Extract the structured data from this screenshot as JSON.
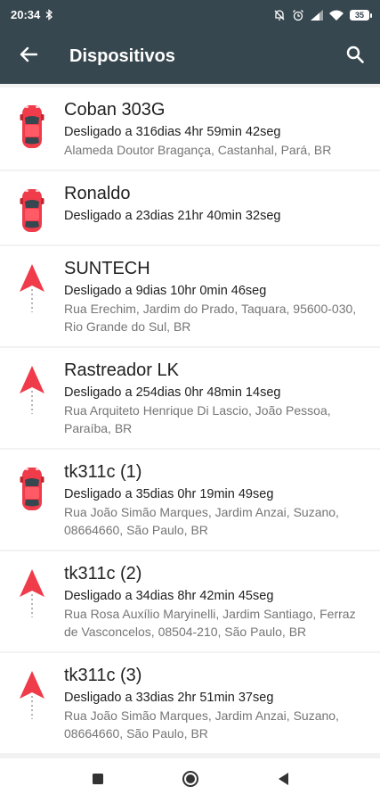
{
  "status_bar": {
    "time": "20:34",
    "battery": "35"
  },
  "header": {
    "title": "Dispositivos"
  },
  "devices": [
    {
      "icon": "car-icon",
      "name": "Coban 303G",
      "status": "Desligado a 316dias 4hr 59min 42seg",
      "address": "Alameda Doutor Bragança, Castanhal, Pará, BR"
    },
    {
      "icon": "car-icon",
      "name": "Ronaldo",
      "status": "Desligado a 23dias 21hr 40min 32seg",
      "address": ""
    },
    {
      "icon": "arrow-icon",
      "name": "SUNTECH",
      "status": "Desligado a 9dias 10hr 0min 46seg",
      "address": "Rua Erechim, Jardim do Prado, Taquara, 95600-030, Rio Grande do Sul, BR"
    },
    {
      "icon": "arrow-icon",
      "name": "Rastreador LK",
      "status": "Desligado a 254dias 0hr 48min 14seg",
      "address": "Rua Arquiteto Henrique Di Lascio, João Pessoa, Paraíba, BR"
    },
    {
      "icon": "car-icon",
      "name": "tk311c (1)",
      "status": "Desligado a 35dias 0hr 19min 49seg",
      "address": "Rua João Simão Marques, Jardim Anzai, Suzano, 08664660, São Paulo, BR"
    },
    {
      "icon": "arrow-icon",
      "name": "tk311c (2)",
      "status": "Desligado a 34dias 8hr 42min 45seg",
      "address": "Rua Rosa Auxílio Maryinelli, Jardim Santiago, Ferraz de Vasconcelos, 08504-210, São Paulo, BR"
    },
    {
      "icon": "arrow-icon",
      "name": "tk311c (3)",
      "status": "Desligado a 33dias 2hr 51min 37seg",
      "address": "Rua João Simão Marques, Jardim Anzai, Suzano, 08664660, São Paulo, BR"
    }
  ],
  "colors": {
    "app_bar": "#37474f",
    "marker": "#ef3b4a",
    "secondary_text": "#757575"
  }
}
